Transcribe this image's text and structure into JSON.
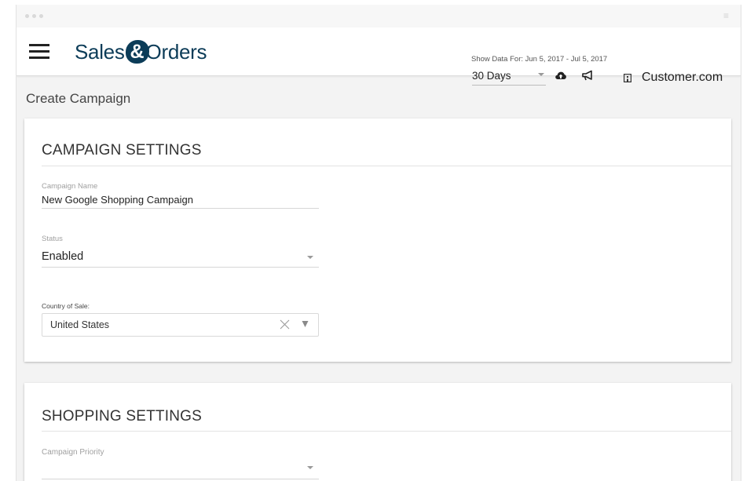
{
  "window": {
    "menu_icon": "hamburger-icon"
  },
  "header": {
    "logo_part1": "Sales",
    "logo_amp": "&",
    "logo_part2": "Orders",
    "show_data_label": "Show Data For: Jun 5, 2017 - Jul 5, 2017",
    "range_value": "30 Days",
    "icons": [
      "cloud-icon",
      "megaphone-icon",
      "building-icon"
    ],
    "customer": "Customer.com",
    "brand_color": "#0c3c58"
  },
  "page": {
    "title": "Create Campaign"
  },
  "campaign_settings": {
    "header": "CAMPAIGN SETTINGS",
    "name_label": "Campaign Name",
    "name_value": "New Google Shopping Campaign",
    "status_label": "Status",
    "status_value": "Enabled",
    "country_label": "Country of Sale:",
    "country_value": "United States"
  },
  "shopping_settings": {
    "header": "SHOPPING SETTINGS",
    "priority_label": "Campaign Priority",
    "priority_value": ""
  }
}
